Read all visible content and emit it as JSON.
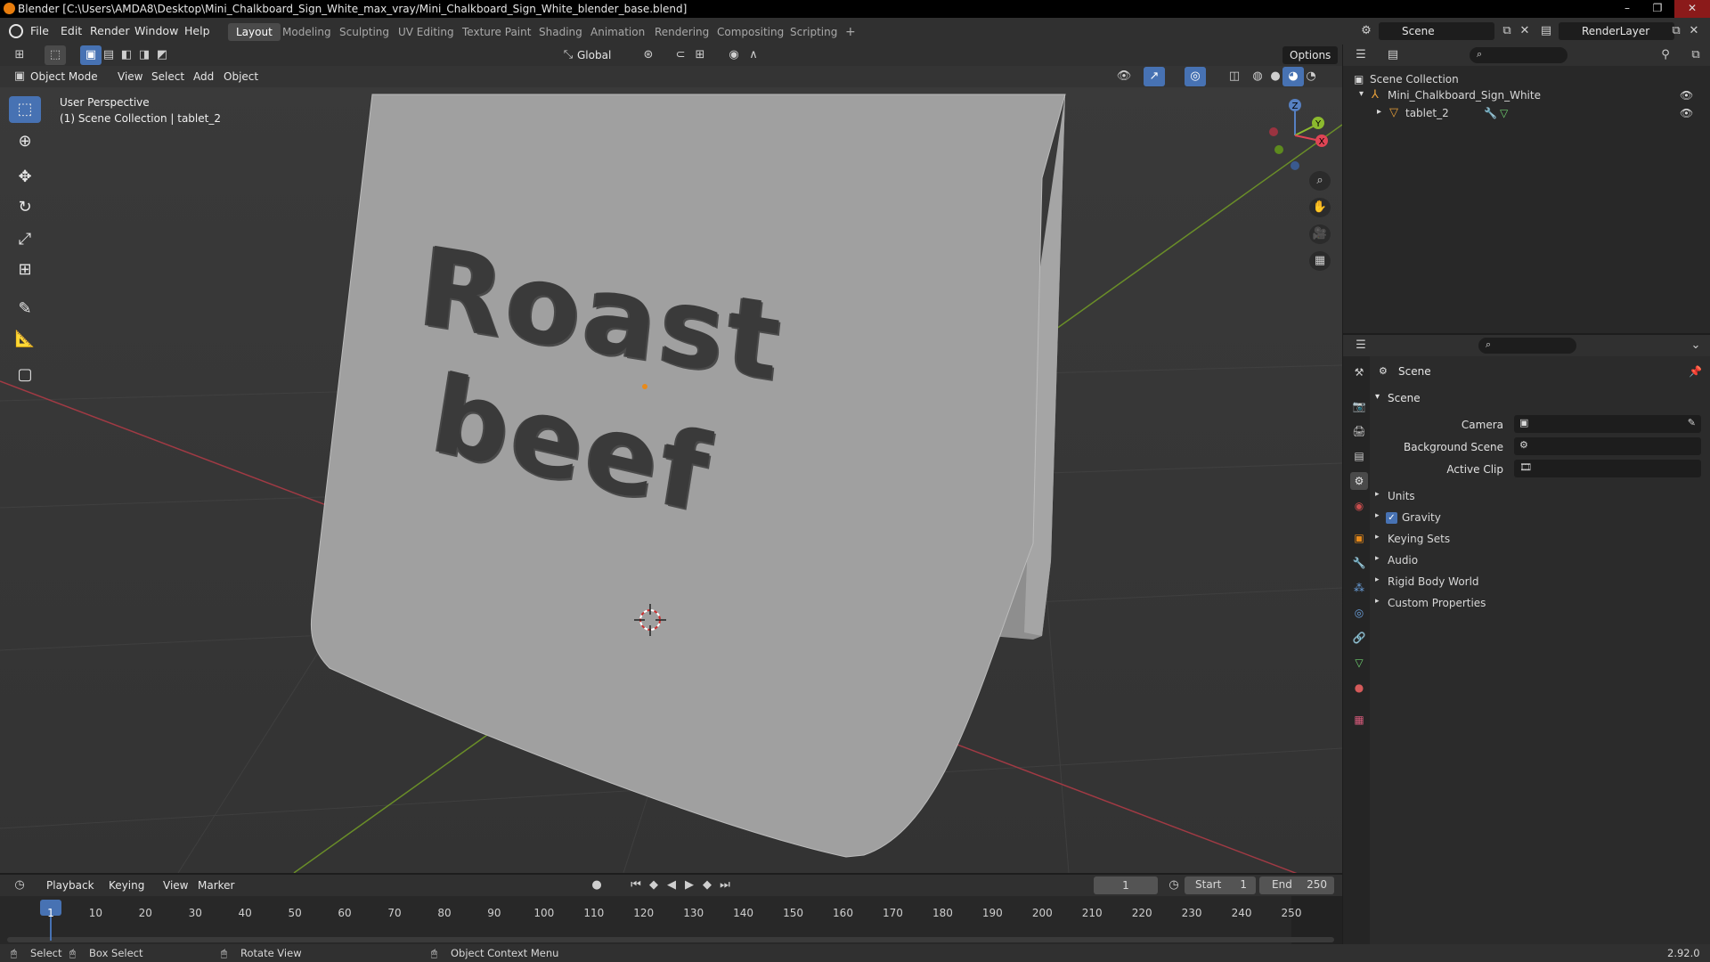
{
  "window": {
    "title": "Blender [C:\\Users\\AMDA8\\Desktop\\Mini_Chalkboard_Sign_White_max_vray/Mini_Chalkboard_Sign_White_blender_base.blend]",
    "controls": [
      "–",
      "❐",
      "✕"
    ]
  },
  "menu": [
    "File",
    "Edit",
    "Render",
    "Window",
    "Help"
  ],
  "workspaces": [
    "Layout",
    "Modeling",
    "Sculpting",
    "UV Editing",
    "Texture Paint",
    "Shading",
    "Animation",
    "Rendering",
    "Compositing",
    "Scripting",
    "+"
  ],
  "top_right": {
    "scene": "Scene",
    "render_layer": "RenderLayer"
  },
  "viewport": {
    "transform_orientation": "Global",
    "options_label": "Options",
    "mode": "Object Mode",
    "header_menus": [
      "View",
      "Select",
      "Add",
      "Object"
    ],
    "overlay_title": "User Perspective",
    "overlay_subtitle": "(1) Scene Collection | tablet_2",
    "sign_text_line1": "Roast",
    "sign_text_line2": "beef",
    "gizmo_axes": [
      "Z",
      "Y",
      "X"
    ],
    "colors": {
      "background": "#3d3d3d",
      "grid_x": "#a13a44",
      "grid_y": "#6a8e28",
      "sign_face": "#a0a0a0",
      "sign_edge": "#c8c8c8",
      "chalk": "#3a3a3a"
    }
  },
  "outliner": {
    "root": "Scene Collection",
    "items": [
      {
        "label": "Mini_Chalkboard_Sign_White"
      },
      {
        "label": "tablet_2"
      }
    ]
  },
  "properties": {
    "context": "Scene",
    "panel": "Scene",
    "camera_label": "Camera",
    "background_scene_label": "Background Scene",
    "active_clip_label": "Active Clip",
    "subpanels": [
      "Units",
      "Gravity",
      "Keying Sets",
      "Audio",
      "Rigid Body World",
      "Custom Properties"
    ],
    "gravity_checked": true
  },
  "timeline": {
    "menus": [
      "Playback",
      "Keying",
      "View",
      "Marker"
    ],
    "current_frame": "1",
    "start_label": "Start",
    "start_value": "1",
    "end_label": "End",
    "end_value": "250",
    "ticks": [
      "1",
      "10",
      "20",
      "30",
      "40",
      "50",
      "60",
      "70",
      "80",
      "90",
      "100",
      "110",
      "120",
      "130",
      "140",
      "150",
      "160",
      "170",
      "180",
      "190",
      "200",
      "210",
      "220",
      "230",
      "240",
      "250"
    ]
  },
  "statusbar": {
    "select": "Select",
    "box_select": "Box Select",
    "rotate_view": "Rotate View",
    "context_menu": "Object Context Menu",
    "version": "2.92.0"
  }
}
